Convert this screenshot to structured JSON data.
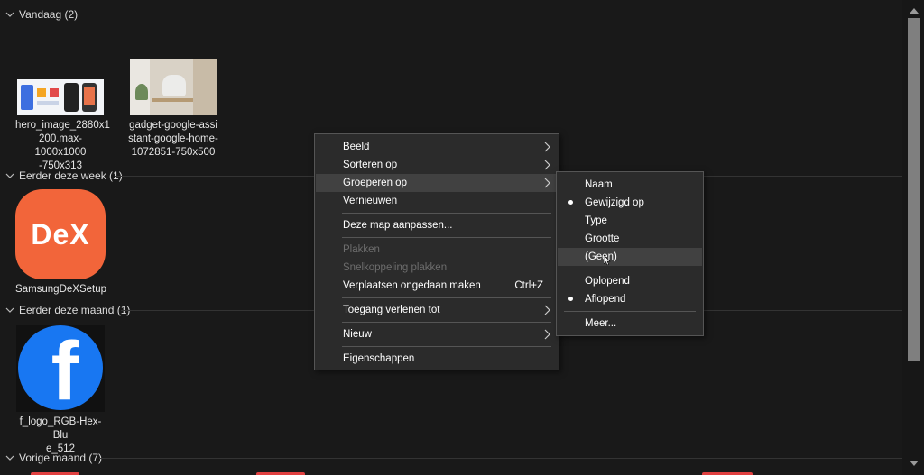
{
  "groups": {
    "today": "Vandaag (2)",
    "week": "Eerder deze week (1)",
    "month": "Eerder deze maand (1)",
    "last_month": "Vorige maand (7)"
  },
  "files": {
    "hero": [
      "hero_image_2880x1",
      "200.max-1000x1000",
      "-750x313"
    ],
    "gadget": [
      "gadget-google-assi",
      "stant-google-home-",
      "1072851-750x500"
    ],
    "dex": [
      "SamsungDeXSetup"
    ],
    "dex_logo_text": "DeX",
    "fb": [
      "f_logo_RGB-Hex-Blu",
      "e_512"
    ],
    "fb_logo_text": "f"
  },
  "context_menu": {
    "beeld": "Beeld",
    "sorteren": "Sorteren op",
    "groeperen": "Groeperen op",
    "vernieuwen": "Vernieuwen",
    "aanpassen": "Deze map aanpassen...",
    "plakken": "Plakken",
    "snelkoppeling": "Snelkoppeling plakken",
    "ongedaan": "Verplaatsen ongedaan maken",
    "ongedaan_shortcut": "Ctrl+Z",
    "toegang": "Toegang verlenen tot",
    "nieuw": "Nieuw",
    "eigenschappen": "Eigenschappen"
  },
  "submenu": {
    "naam": "Naam",
    "gewijzigd": "Gewijzigd op",
    "type": "Type",
    "grootte": "Grootte",
    "geen": "(Geen)",
    "oplopend": "Oplopend",
    "aflopend": "Aflopend",
    "meer": "Meer..."
  },
  "colors": {
    "background": "#191919",
    "menu_bg": "#2b2b2b",
    "highlight": "#414141",
    "dex_orange": "#f2653a",
    "facebook_blue": "#1877f2"
  }
}
